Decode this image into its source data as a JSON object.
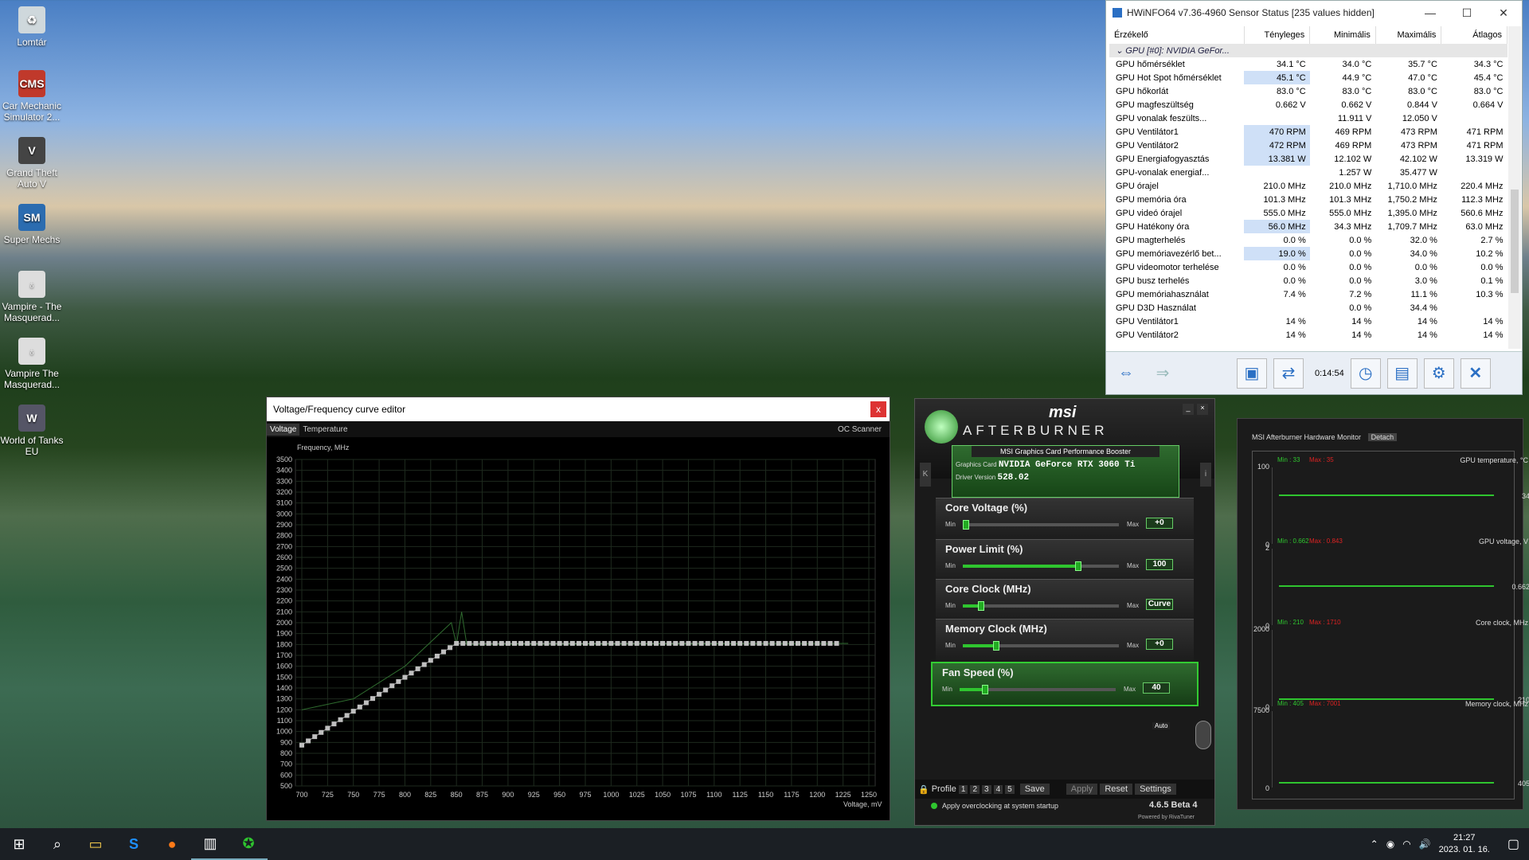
{
  "desktop": {
    "icons": [
      {
        "label": "Lomtár",
        "icon": "recycle-bin-icon",
        "color": "#cfd8dc"
      },
      {
        "label": "Car Mechanic Simulator 2...",
        "icon": "cms-icon",
        "color": "#c0392b",
        "glyph": "CMS"
      },
      {
        "label": "Grand Theft Auto V",
        "icon": "gta-icon",
        "color": "#444",
        "glyph": "V"
      },
      {
        "label": "Super Mechs",
        "icon": "super-mechs-icon",
        "color": "#2b6cb0",
        "glyph": "SM"
      },
      {
        "label": "Vampire - The Masquerad...",
        "icon": "vampire-icon",
        "color": "#ddd",
        "glyph": "♁"
      },
      {
        "label": "Vampire The Masquerad...",
        "icon": "vampire-icon",
        "color": "#ddd",
        "glyph": "♁"
      },
      {
        "label": "World of Tanks EU",
        "icon": "wot-icon",
        "color": "#556",
        "glyph": "W"
      }
    ]
  },
  "hwinfo": {
    "title": "HWiNFO64 v7.36-4960 Sensor Status [235 values hidden]",
    "headers": [
      "Érzékelő",
      "Tényleges",
      "Minimális",
      "Maximális",
      "Átlagos"
    ],
    "group": "GPU [#0]: NVIDIA GeFor...",
    "rows": [
      {
        "name": "GPU hőmérséklet",
        "cur": "34.1 °C",
        "min": "34.0 °C",
        "max": "35.7 °C",
        "avg": "34.3 °C"
      },
      {
        "name": "GPU Hot Spot hőmérséklet",
        "cur": "45.1 °C",
        "min": "44.9 °C",
        "max": "47.0 °C",
        "avg": "45.4 °C",
        "hl": true
      },
      {
        "name": "GPU hőkorlát",
        "cur": "83.0 °C",
        "min": "83.0 °C",
        "max": "83.0 °C",
        "avg": "83.0 °C"
      },
      {
        "name": "GPU magfeszültség",
        "cur": "0.662 V",
        "min": "0.662 V",
        "max": "0.844 V",
        "avg": "0.664 V"
      },
      {
        "name": "GPU vonalak feszülts...",
        "cur": "",
        "min": "11.911 V",
        "max": "12.050 V",
        "avg": ""
      },
      {
        "name": "GPU Ventilátor1",
        "cur": "470 RPM",
        "min": "469 RPM",
        "max": "473 RPM",
        "avg": "471 RPM",
        "hl": true
      },
      {
        "name": "GPU Ventilátor2",
        "cur": "472 RPM",
        "min": "469 RPM",
        "max": "473 RPM",
        "avg": "471 RPM",
        "hl": true
      },
      {
        "name": "GPU Energiafogyasztás",
        "cur": "13.381 W",
        "min": "12.102 W",
        "max": "42.102 W",
        "avg": "13.319 W",
        "hl": true
      },
      {
        "name": "GPU-vonalak energiaf...",
        "cur": "",
        "min": "1.257 W",
        "max": "35.477 W",
        "avg": ""
      },
      {
        "name": "GPU órajel",
        "cur": "210.0 MHz",
        "min": "210.0 MHz",
        "max": "1,710.0 MHz",
        "avg": "220.4 MHz"
      },
      {
        "name": "GPU memória óra",
        "cur": "101.3 MHz",
        "min": "101.3 MHz",
        "max": "1,750.2 MHz",
        "avg": "112.3 MHz"
      },
      {
        "name": "GPU videó órajel",
        "cur": "555.0 MHz",
        "min": "555.0 MHz",
        "max": "1,395.0 MHz",
        "avg": "560.6 MHz"
      },
      {
        "name": "GPU Hatékony óra",
        "cur": "56.0 MHz",
        "min": "34.3 MHz",
        "max": "1,709.7 MHz",
        "avg": "63.0 MHz",
        "hl": true
      },
      {
        "name": "GPU magterhelés",
        "cur": "0.0 %",
        "min": "0.0 %",
        "max": "32.0 %",
        "avg": "2.7 %"
      },
      {
        "name": "GPU memóriavezérlő bet...",
        "cur": "19.0 %",
        "min": "0.0 %",
        "max": "34.0 %",
        "avg": "10.2 %",
        "hl": true
      },
      {
        "name": "GPU videomotor terhelése",
        "cur": "0.0 %",
        "min": "0.0 %",
        "max": "0.0 %",
        "avg": "0.0 %"
      },
      {
        "name": "GPU busz terhelés",
        "cur": "0.0 %",
        "min": "0.0 %",
        "max": "3.0 %",
        "avg": "0.1 %"
      },
      {
        "name": "GPU memóriahasználat",
        "cur": "7.4 %",
        "min": "7.2 %",
        "max": "11.1 %",
        "avg": "10.3 %"
      },
      {
        "name": "GPU D3D Használat",
        "cur": "",
        "min": "0.0 %",
        "max": "34.4 %",
        "avg": ""
      },
      {
        "name": "GPU Ventilátor1",
        "cur": "14 %",
        "min": "14 %",
        "max": "14 %",
        "avg": "14 %"
      },
      {
        "name": "GPU Ventilátor2",
        "cur": "14 %",
        "min": "14 %",
        "max": "14 %",
        "avg": "14 %"
      }
    ],
    "timer": "0:14:54"
  },
  "vf_editor": {
    "title": "Voltage/Frequency curve editor",
    "close": "x",
    "tabs": [
      "Voltage",
      "Temperature"
    ],
    "oc_scanner": "OC Scanner",
    "ylabel": "Frequency, MHz",
    "xlabel": "Voltage, mV",
    "yticks": [
      "3500",
      "3400",
      "3300",
      "3200",
      "3100",
      "3000",
      "2900",
      "2800",
      "2700",
      "2600",
      "2500",
      "2400",
      "2300",
      "2200",
      "2100",
      "2000",
      "1900",
      "1800",
      "1700",
      "1600",
      "1500",
      "1400",
      "1300",
      "1200",
      "1100",
      "1000",
      "900",
      "800",
      "700",
      "600",
      "500"
    ],
    "xticks": [
      "700",
      "725",
      "750",
      "775",
      "800",
      "825",
      "850",
      "875",
      "900",
      "925",
      "950",
      "975",
      "1000",
      "1025",
      "1050",
      "1075",
      "1100",
      "1125",
      "1150",
      "1175",
      "1200",
      "1225",
      "1250"
    ]
  },
  "afterburner": {
    "brand": "msi",
    "name": "AFTERBURNER",
    "subtitle": "MSI Graphics Card Performance Booster",
    "gpu_label": "Graphics Card",
    "gpu_value": "NVIDIA GeForce RTX 3060 Ti",
    "driver_label": "Driver Version",
    "driver_value": "528.02",
    "sliders": [
      {
        "label": "Core Voltage (%)",
        "min": "Min",
        "max": "Max",
        "value": "+0",
        "fill": 0.0
      },
      {
        "label": "Power Limit (%)",
        "min": "Min",
        "max": "Max",
        "value": "100",
        "fill": 0.75
      },
      {
        "label": "Core Clock (MHz)",
        "min": "Min",
        "max": "Max",
        "value": "Curve",
        "fill": 0.1
      },
      {
        "label": "Memory Clock (MHz)",
        "min": "Min",
        "max": "Max",
        "value": "+0",
        "fill": 0.2
      },
      {
        "label": "Fan Speed (%)",
        "min": "Min",
        "max": "Max",
        "value": "40",
        "fill": 0.15
      }
    ],
    "fan_auto": "Auto",
    "profile_label": "Profile",
    "profiles": [
      "1",
      "2",
      "3",
      "4",
      "5"
    ],
    "save": "Save",
    "apply": "Apply",
    "reset": "Reset",
    "settings": "Settings",
    "startup_text": "Apply overclocking at system startup",
    "version": "4.6.5 Beta 4",
    "powered": "Powered by RivaTuner"
  },
  "hw_monitor": {
    "title": "MSI Afterburner Hardware Monitor",
    "detach": "Detach",
    "graphs": [
      {
        "title": "GPU temperature, °C",
        "min": "Min : 33",
        "max": "Max : 35",
        "top": "100",
        "bottom": "0",
        "current": "34"
      },
      {
        "title": "GPU voltage, V",
        "min": "Min : 0.662",
        "max": "Max : 0.843",
        "top": "2",
        "bottom": "0",
        "current": "0.662"
      },
      {
        "title": "Core clock, MHz",
        "min": "Min : 210",
        "max": "Max : 1710",
        "top": "2000",
        "bottom": "0",
        "current": "210"
      },
      {
        "title": "Memory clock, MHz",
        "min": "Min : 405",
        "max": "Max : 7001",
        "top": "7500",
        "bottom": "0",
        "current": "405"
      }
    ]
  },
  "taskbar": {
    "time": "21:27",
    "date": "2023. 01. 16."
  }
}
